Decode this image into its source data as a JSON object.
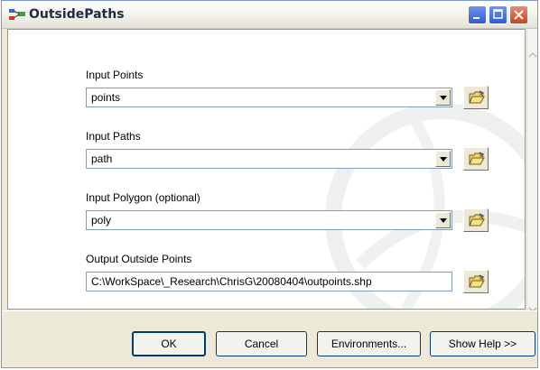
{
  "window": {
    "title": "OutsidePaths",
    "title_color": "#1f2a44"
  },
  "fields": {
    "input_points": {
      "label": "Input Points",
      "value": "points"
    },
    "input_paths": {
      "label": "Input Paths",
      "value": "path"
    },
    "input_polygon": {
      "label": "Input Polygon (optional)",
      "value": "poly"
    },
    "output_points": {
      "label": "Output Outside Points",
      "value": "C:\\WorkSpace\\_Research\\ChrisG\\20080404\\outpoints.shp"
    }
  },
  "buttons": {
    "ok": "OK",
    "cancel": "Cancel",
    "environments": "Environments...",
    "show_help": "Show Help >>"
  },
  "colors": {
    "dialog_bg": "#ece9d8",
    "field_border": "#7f9db9",
    "button_border": "#003c74"
  },
  "icons": [
    "app-icon",
    "minimize-icon",
    "maximize-icon",
    "close-icon",
    "dropdown-arrow-icon",
    "open-folder-icon"
  ]
}
